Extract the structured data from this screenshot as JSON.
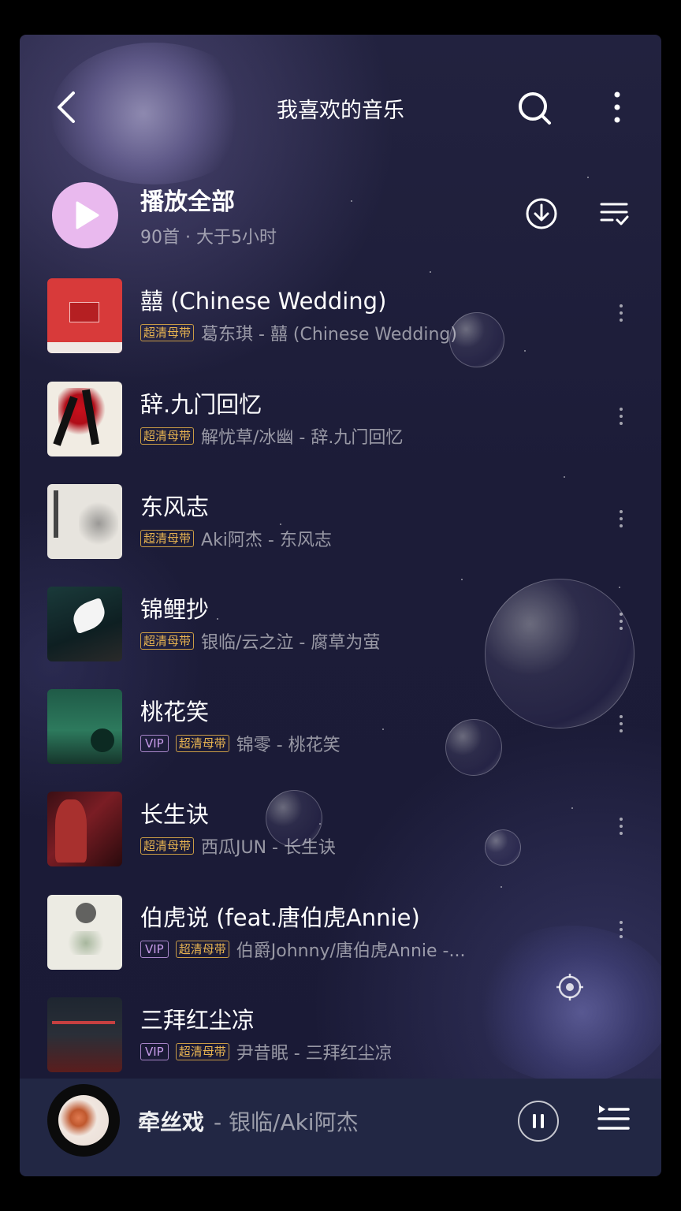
{
  "header": {
    "title": "我喜欢的音乐",
    "back_icon": "chevron-left-icon",
    "search_icon": "search-icon",
    "more_icon": "more-vertical-icon"
  },
  "play_all": {
    "label": "播放全部",
    "subtitle": "90首 · 大于5小时",
    "download_icon": "download-icon",
    "sort_icon": "sort-list-icon"
  },
  "songs": [
    {
      "title": "囍 (Chinese Wedding)",
      "badges": [
        "超清母带"
      ],
      "meta": "葛东琪 - 囍 (Chinese Wedding)"
    },
    {
      "title": "辞.九门回忆",
      "badges": [
        "超清母带"
      ],
      "meta": "解忧草/冰幽 - 辞.九门回忆"
    },
    {
      "title": "东风志",
      "badges": [
        "超清母带"
      ],
      "meta": "Aki阿杰 - 东风志"
    },
    {
      "title": "锦鲤抄",
      "badges": [
        "超清母带"
      ],
      "meta": "银临/云之泣 - 腐草为萤"
    },
    {
      "title": "桃花笑",
      "badges": [
        "VIP",
        "超清母带"
      ],
      "meta": "锦零 - 桃花笑"
    },
    {
      "title": "长生诀",
      "badges": [
        "超清母带"
      ],
      "meta": "西瓜JUN - 长生诀"
    },
    {
      "title": "伯虎说 (feat.唐伯虎Annie)",
      "badges": [
        "VIP",
        "超清母带"
      ],
      "meta": "伯爵Johnny/唐伯虎Annie -..."
    },
    {
      "title": "三拜红尘凉",
      "badges": [
        "VIP",
        "超清母带"
      ],
      "meta": "尹昔眠 - 三拜红尘凉"
    }
  ],
  "now_playing": {
    "title": "牵丝戏",
    "artist": "- 银临/Aki阿杰",
    "pause_icon": "pause-icon",
    "playlist_icon": "playlist-icon"
  },
  "colors": {
    "background": "#1c1c38",
    "play_button": "#e9b9ee",
    "hq_badge": "#e8b451",
    "vip_badge": "#c79be9",
    "player_bar": "#222744"
  }
}
